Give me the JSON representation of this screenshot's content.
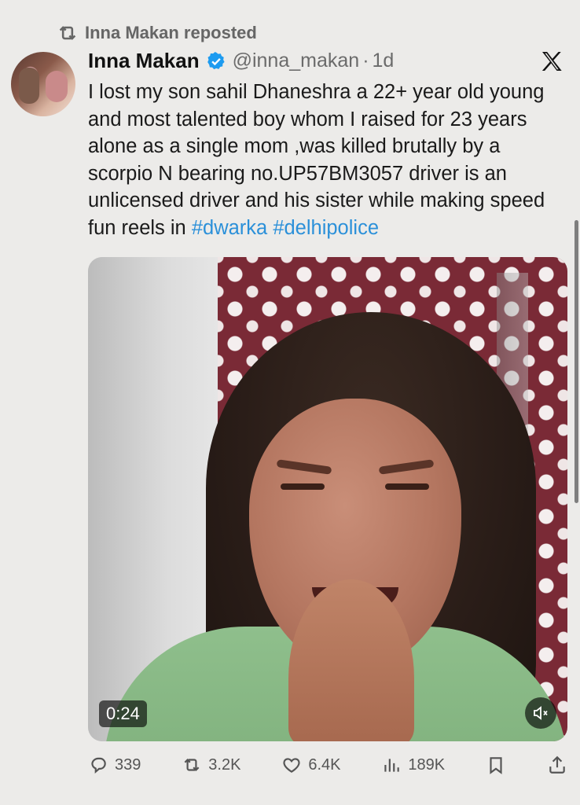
{
  "repost": {
    "label": "Inna Makan reposted"
  },
  "tweet": {
    "author_name": "Inna Makan",
    "handle": "@inna_makan",
    "separator": "·",
    "time": "1d",
    "text_plain": "I lost my son sahil Dhaneshra a 22+ year old young and most talented boy whom I raised for 23 years alone as a single mom ,was killed brutally by a scorpio N bearing no.UP57BM3057 driver is an unlicensed driver and his sister while making speed fun reels in ",
    "hashtag_1": "#dwarka",
    "hashtag_2": "#delhipolice"
  },
  "media": {
    "duration": "0:24",
    "muted": true
  },
  "actions": {
    "replies": "339",
    "reposts": "3.2K",
    "likes": "6.4K",
    "views": "189K"
  },
  "colors": {
    "accent": "#2b90d9",
    "muted_text": "#6b6b6b",
    "background": "#ecebe9"
  },
  "icons": {
    "repost": "repost-icon",
    "verified": "verified-badge-icon",
    "brand": "x-logo-icon",
    "reply": "reply-icon",
    "like": "heart-icon",
    "views": "views-chart-icon",
    "bookmark": "bookmark-icon",
    "share": "share-icon",
    "mute": "volume-muted-icon"
  }
}
